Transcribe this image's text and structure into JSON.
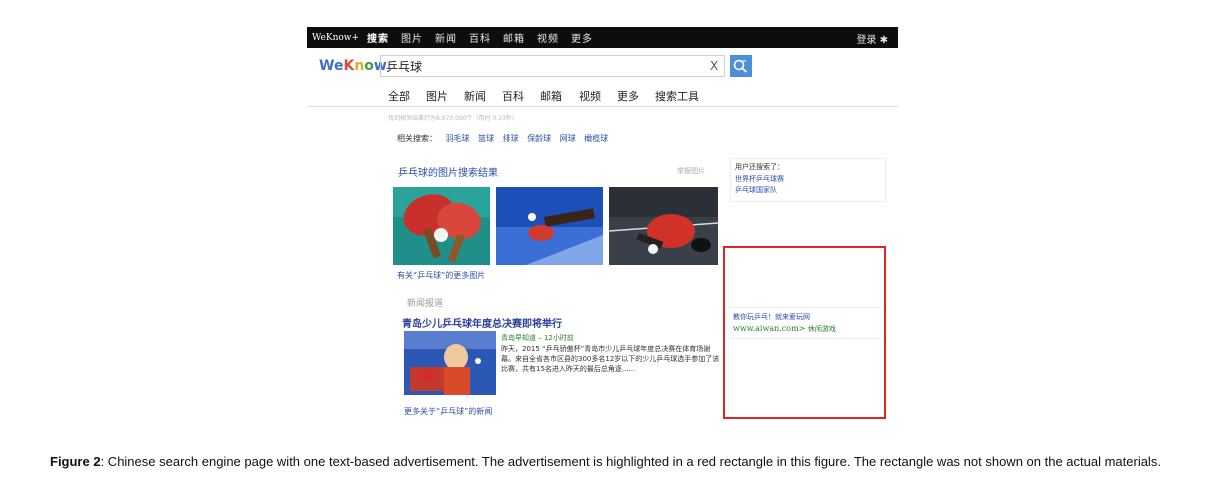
{
  "topbar": {
    "brand": "WeKnow+",
    "items": [
      "搜索",
      "图片",
      "新闻",
      "百科",
      "邮箱",
      "视频",
      "更多"
    ],
    "login": "登录 ✱"
  },
  "search": {
    "logo": {
      "we": "We",
      "k": "K",
      "n": "n",
      "o": "o",
      "w": "w"
    },
    "query": "乒乓球",
    "clear": "X"
  },
  "tabs": [
    "全部",
    "图片",
    "新闻",
    "百科",
    "邮箱",
    "视频",
    "更多",
    "搜索工具"
  ],
  "result_count": "找到相关结果约为8,970,000个（用时 0.33秒）",
  "related": {
    "label": "相关搜索：",
    "links": [
      "羽毛球",
      "篮球",
      "排球",
      "保龄球",
      "网球",
      "橄榄球"
    ]
  },
  "images": {
    "title": "乒乓球的图片搜索结果",
    "report": "举报图片",
    "more": "有关“乒乓球”的更多图片"
  },
  "news": {
    "label": "新闻报道",
    "title": "青岛少儿乒乓球年度总决赛即将举行",
    "meta": "青岛早知道 – 12小时前",
    "body": "昨天，2015 “乒乓骄傲杯”青岛市少儿乒乓球年度总决赛在体育场谢幕。来自全省各市区县的300多名12岁以下的少儿乒乓球选手参加了该比赛，共有15名进入昨天的最后总角逐......",
    "more": "更多关于“乒乓球”的新闻"
  },
  "sidebar": {
    "also_title": "用户还搜索了：",
    "also_links": [
      "世界杯乒乓球赛",
      "乒乓球国家队"
    ]
  },
  "ad": {
    "title": "教你玩乒乓！就来爱玩网",
    "url": "www.aiwan.com>",
    "category": "休闲游戏"
  },
  "caption": {
    "label": "Figure 2",
    "text": ": Chinese search engine page with one text-based advertisement. The advertisement is highlighted in a red rectangle in this figure. The rectangle was not shown on the actual materials."
  },
  "colors": {
    "highlight": "#e02424",
    "link": "#2a4ea8",
    "url_green": "#2e7d32"
  }
}
